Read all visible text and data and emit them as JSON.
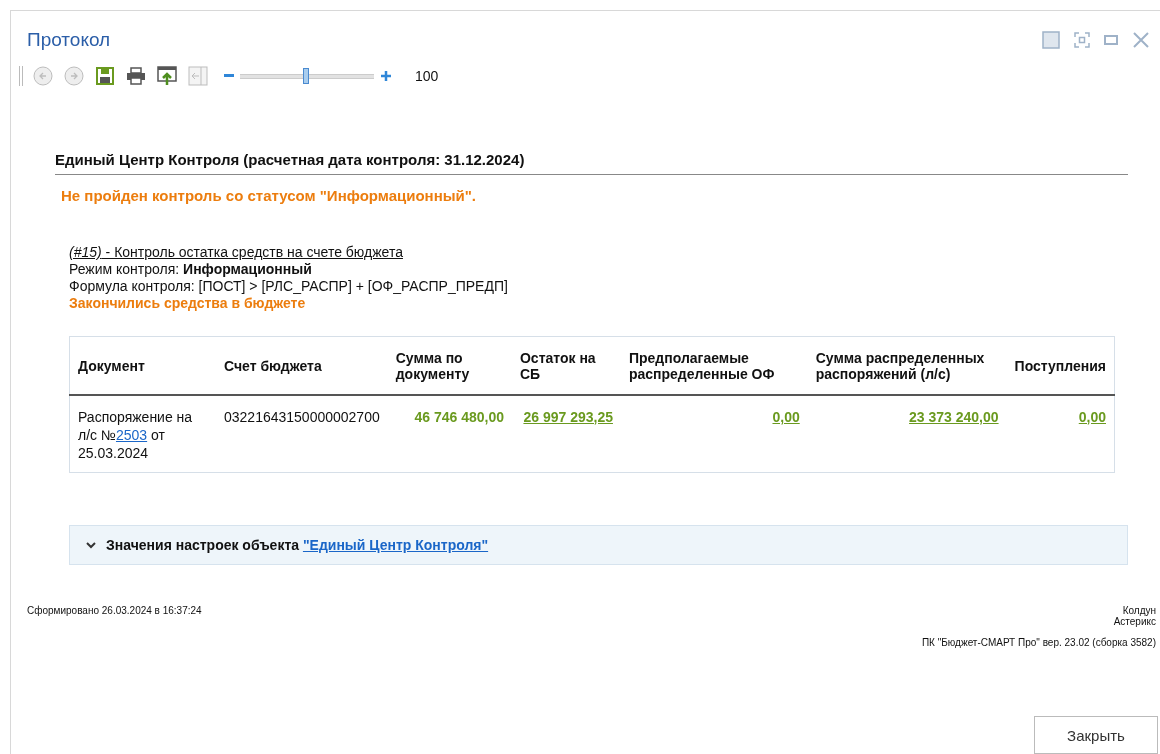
{
  "window": {
    "title": "Протокол"
  },
  "toolbar": {
    "buttons": [
      {
        "kind": "back",
        "disabled": true
      },
      {
        "kind": "forward",
        "disabled": true
      },
      {
        "kind": "save",
        "disabled": false
      },
      {
        "kind": "print",
        "disabled": false
      },
      {
        "kind": "export",
        "disabled": false
      },
      {
        "kind": "panel",
        "disabled": true
      }
    ],
    "zoom": {
      "level": 0.49,
      "value": "100"
    }
  },
  "report": {
    "heading": "Единый Центр Контроля (расчетная дата контроля: 31.12.2024)",
    "status": "Не пройден контроль со статусом \"Информационный\".",
    "control": {
      "number": "(#15)",
      "name": " - Контроль остатка средств на счете бюджета",
      "mode_label": "Режим контроля: ",
      "mode": "Информационный",
      "formula": "Формула контроля: [ПОСТ] > [РЛС_РАСПР] + [ОФ_РАСПР_ПРЕДП]",
      "message": "Закончились средства в бюджете"
    },
    "table": {
      "columns": [
        "Документ",
        "Счет бюджета",
        "Сумма по документу",
        "Остаток на СБ",
        "Предполагаемые распределенные ОФ",
        "Сумма распределенных распоряжений (л/с)",
        "Поступления"
      ],
      "rows": [
        [
          {
            "kind": "doc",
            "before": "Распоряжение на л/с №",
            "link": "2503",
            "after": " от 25.03.2024"
          },
          {
            "kind": "text",
            "text": "03221643150000002700"
          },
          {
            "kind": "amount",
            "text": "46 746 480,00",
            "linked": false
          },
          {
            "kind": "amount",
            "text": "26 997 293,25",
            "linked": true
          },
          {
            "kind": "amount",
            "text": "0,00",
            "linked": true
          },
          {
            "kind": "amount",
            "text": "23 373 240,00",
            "linked": true
          },
          {
            "kind": "amount",
            "text": "0,00",
            "linked": true
          }
        ]
      ]
    },
    "settings": {
      "expanded": false,
      "label": "Значения настроек объекта ",
      "link": "\"Единый Центр Контроля\""
    },
    "generated": "Сформировано 26.03.2024 в 16:37:24",
    "user": "Колдун",
    "org": "Астерикс",
    "version": "ПК \"Бюджет-СМАРТ Про\" вер. 23.02 (сборка 3582)"
  },
  "buttons": [
    "Закрыть"
  ]
}
